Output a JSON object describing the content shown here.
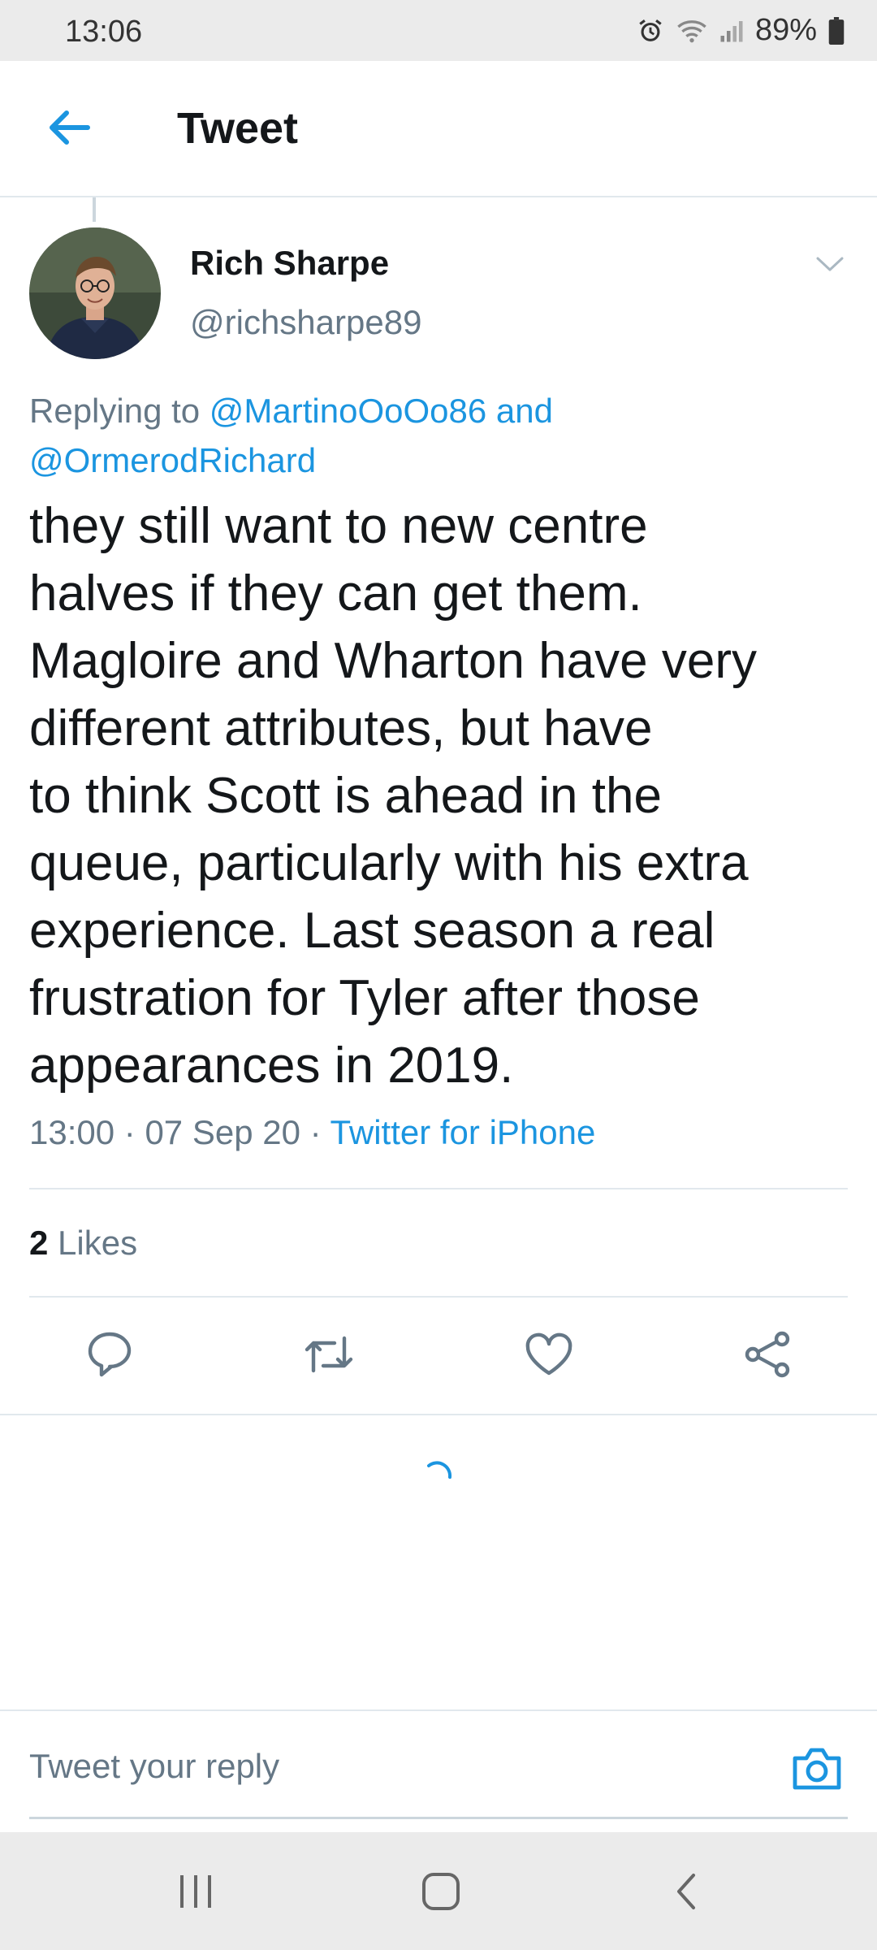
{
  "status_bar": {
    "time": "13:06",
    "battery": "89%",
    "icons": [
      "alarm-icon",
      "wifi-icon",
      "signal-icon",
      "battery-icon"
    ]
  },
  "header": {
    "title": "Tweet",
    "back_icon": "arrow-left-icon"
  },
  "tweet": {
    "author_name": "Rich Sharpe",
    "author_handle": "@richsharpe89",
    "replying_prefix": "Replying to ",
    "mention_1": "@MartinoOoOo86",
    "mention_joiner": " and",
    "mention_2": "@OrmerodRichard",
    "text": "they still want to new centre\nhalves if they can get them.\nMagloire and Wharton have very\ndifferent attributes, but have\nto think Scott is ahead in the\nqueue, particularly with his extra\nexperience. Last season a real\nfrustration for Tyler after those\nappearances in 2019.",
    "time": "13:00",
    "date": "07 Sep 20",
    "separator": " · ",
    "client": "Twitter for iPhone",
    "likes_count": "2",
    "likes_label": " Likes"
  },
  "actions": [
    {
      "icon": "reply-icon"
    },
    {
      "icon": "retweet-icon"
    },
    {
      "icon": "heart-icon"
    },
    {
      "icon": "share-icon"
    }
  ],
  "composer": {
    "placeholder": "Tweet your reply",
    "camera_icon": "camera-icon"
  },
  "nav_bar": {
    "icons": [
      "recents-icon",
      "home-icon",
      "back-icon"
    ]
  },
  "colors": {
    "accent": "#1b95e0",
    "text_primary": "#14171a",
    "text_secondary": "#657786",
    "divider": "#e1e8ed",
    "system_bar": "#ebebeb"
  }
}
